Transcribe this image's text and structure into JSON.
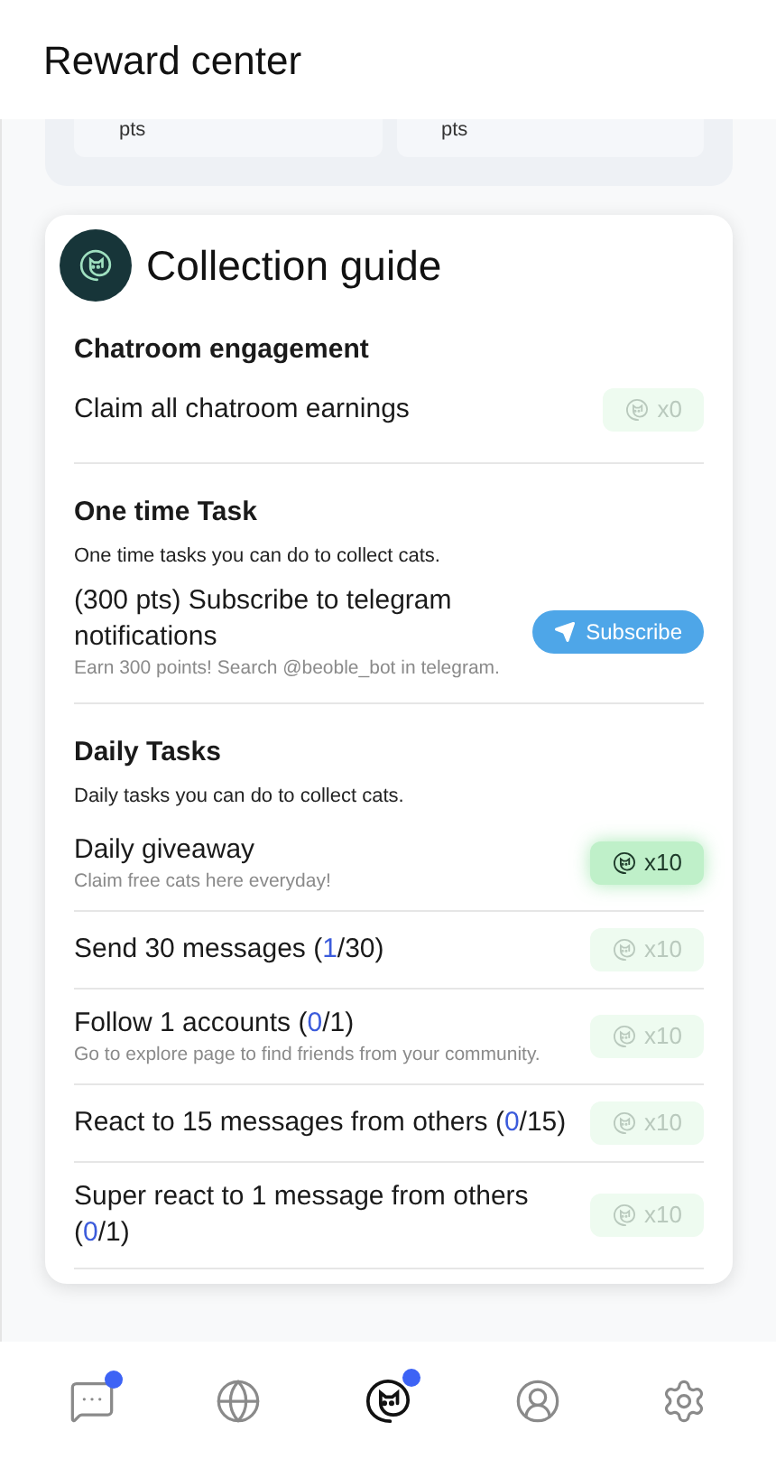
{
  "header": {
    "title": "Reward center"
  },
  "stats": [
    {
      "unit": "pts"
    },
    {
      "unit": "pts"
    }
  ],
  "guide": {
    "title": "Collection guide",
    "sections": [
      {
        "heading": "Chatroom engagement",
        "tasks": [
          {
            "kind": "reward",
            "title": "Claim all chatroom earnings",
            "reward": "x0",
            "claimable": false
          }
        ]
      },
      {
        "heading": "One time Task",
        "description": "One time tasks  you can do to collect cats.",
        "tasks": [
          {
            "kind": "subscribe",
            "title": "(300 pts) Subscribe to telegram notifications",
            "subtitle": "Earn 300 points! Search @beoble_bot in telegram.",
            "button": "Subscribe"
          }
        ]
      },
      {
        "heading": "Daily Tasks",
        "description": "Daily tasks  you can do to collect cats.",
        "tasks": [
          {
            "kind": "reward",
            "title": "Daily giveaway",
            "subtitle": "Claim free cats here everyday!",
            "reward": "x10",
            "claimable": true
          },
          {
            "kind": "reward",
            "title": "Send 30 messages (",
            "count": "1",
            "title_end": "/30)",
            "reward": "x10",
            "claimable": false
          },
          {
            "kind": "reward",
            "title": "Follow 1 accounts (",
            "count": "0",
            "title_end": "/1)",
            "subtitle": "Go to explore page to find friends from your community.",
            "reward": "x10",
            "claimable": false
          },
          {
            "kind": "reward",
            "title": "React to 15 messages from others (",
            "count": "0",
            "title_end": "/15)",
            "reward": "x10",
            "claimable": false
          },
          {
            "kind": "reward",
            "title": "Super react to 1 message from others (",
            "count": "0",
            "title_end": "/1)",
            "reward": "x10",
            "claimable": false
          }
        ]
      }
    ]
  },
  "nav": [
    {
      "kind": "chat",
      "selected": false,
      "badge": true
    },
    {
      "kind": "globe",
      "selected": false,
      "badge": false
    },
    {
      "kind": "cat",
      "selected": true,
      "badge": true
    },
    {
      "kind": "profile",
      "selected": false,
      "badge": false
    },
    {
      "kind": "settings",
      "selected": false,
      "badge": false
    }
  ]
}
